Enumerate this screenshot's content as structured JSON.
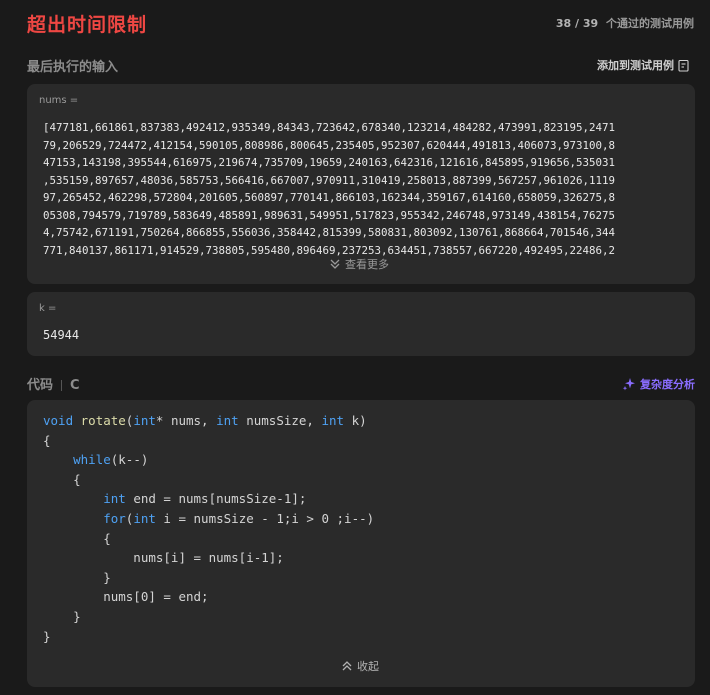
{
  "header": {
    "status_title": "超出时间限制",
    "passed": "38 / 39",
    "passed_suffix": "个通过的测试用例"
  },
  "last_input": {
    "label": "最后执行的输入",
    "add_to_testcase": "添加到测试用例",
    "nums_label": "nums =",
    "nums_lines": [
      "[477181,661861,837383,492412,935349,84343,723642,678340,123214,484282,473991,823195,2471",
      "79,206529,724472,412154,590105,808986,800645,235405,952307,620444,491813,406073,973100,8",
      "47153,143198,395544,616975,219674,735709,19659,240163,642316,121616,845895,919656,535031",
      ",535159,897657,48036,585753,566416,667007,970911,310419,258013,887399,567257,961026,1119",
      "97,265452,462298,572804,201605,560897,770141,866103,162344,359167,614160,658059,326275,8",
      "05308,794579,719789,583649,485891,989631,549951,517823,955342,246748,973149,438154,76275",
      "4,75742,671191,750264,866855,556036,358442,815399,580831,803092,130761,868664,701546,344",
      "771,840137,861171,914529,738805,595480,896469,237253,634451,738557,667220,492495,22486,2"
    ],
    "see_more": "查看更多",
    "k_label": "k =",
    "k_value": "54944"
  },
  "code_section": {
    "label": "代码",
    "language": "C",
    "complexity": "复杂度分析",
    "collapse": "收起"
  },
  "icons": {
    "add_testcase": "clipboard-add-icon",
    "see_more": "chevron-double-down-icon",
    "complexity": "sparkle-icon",
    "collapse": "chevron-double-up-icon"
  },
  "colors": {
    "title": "#ef4743",
    "keyword": "#4ea1f3",
    "ai": "#8a6dff"
  }
}
